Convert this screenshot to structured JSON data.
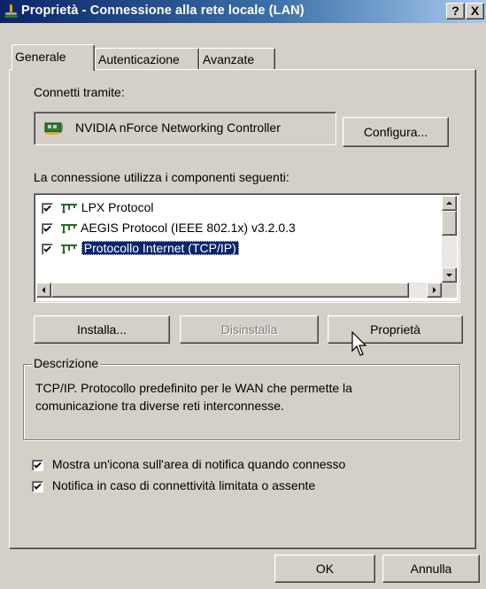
{
  "window": {
    "title": "Proprietà - Connessione alla rete locale (LAN)",
    "help_button": "?",
    "close_button": "X"
  },
  "tabs": [
    {
      "label": "Generale",
      "active": true
    },
    {
      "label": "Autenticazione",
      "active": false
    },
    {
      "label": "Avanzate",
      "active": false
    }
  ],
  "connect_via": {
    "label": "Connetti tramite:",
    "adapter_name": "NVIDIA nForce Networking Controller",
    "configure_button": "Configura..."
  },
  "components": {
    "label": "La connessione utilizza i componenti seguenti:",
    "items": [
      {
        "label": "LPX Protocol",
        "checked": true,
        "selected": false
      },
      {
        "label": "AEGIS Protocol (IEEE 802.1x) v3.2.0.3",
        "checked": true,
        "selected": false
      },
      {
        "label": "Protocollo Internet (TCP/IP)",
        "checked": true,
        "selected": true
      }
    ]
  },
  "actions": {
    "install": "Installa...",
    "uninstall": "Disinstalla",
    "properties": "Proprietà"
  },
  "description": {
    "legend": "Descrizione",
    "text_line1": "TCP/IP. Protocollo predefinito per le WAN che permette la",
    "text_line2": "comunicazione tra diverse reti interconnesse."
  },
  "options": {
    "show_icon": {
      "label": "Mostra un'icona sull'area di notifica quando connesso",
      "checked": true
    },
    "notify_limited": {
      "label": "Notifica in caso di connettività limitata o assente",
      "checked": true
    }
  },
  "footer": {
    "ok": "OK",
    "cancel": "Annulla"
  },
  "colors": {
    "titlebar_start": "#0a246a",
    "titlebar_end": "#a6caf0",
    "face": "#d4d0c8",
    "selection": "#0a246a"
  },
  "icons": {
    "title": "network-connection-icon",
    "adapter": "network-card-icon",
    "component": "network-protocol-icon",
    "cursor": "mouse-pointer-icon"
  }
}
